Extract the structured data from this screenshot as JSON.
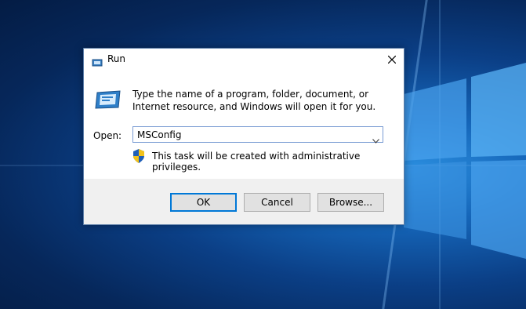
{
  "dialog": {
    "title": "Run",
    "description": "Type the name of a program, folder, document, or Internet resource, and Windows will open it for you.",
    "open_label": "Open:",
    "open_value": "MSConfig",
    "admin_note": "This task will be created with administrative privileges."
  },
  "buttons": {
    "ok": "OK",
    "cancel": "Cancel",
    "browse": "Browse..."
  },
  "icons": {
    "title": "run-icon",
    "close": "close-icon",
    "dropdown": "chevron-down-icon",
    "shield": "uac-shield-icon",
    "large": "run-icon"
  },
  "colors": {
    "accent": "#0078d7",
    "footer_bg": "#f0f0f0",
    "desktop_blue": "#0b3f86"
  }
}
